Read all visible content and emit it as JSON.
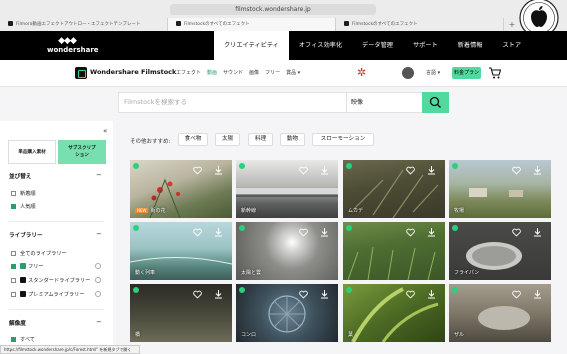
{
  "browser": {
    "url": "filmstock.wondershare.jp",
    "tabs": [
      {
        "label": "Filmora動画エフェクトアウトロー・エフェクトテンプレート",
        "active": true
      },
      {
        "label": "Filmstockのすべてのエフェクト",
        "active": false
      },
      {
        "label": "Filmstockのすべてのエフェクト",
        "active": false
      }
    ],
    "status_url": "https://filmstock.wondershare.jp/c/Forest.html\" を新規タブで開く"
  },
  "ws_nav": {
    "logo": "wondershare",
    "items": [
      {
        "label": "クリエイティビティ",
        "active": true
      },
      {
        "label": "オフィス効率化",
        "active": false
      },
      {
        "label": "データ管理",
        "active": false
      },
      {
        "label": "サポート",
        "active": false
      },
      {
        "label": "新着情報",
        "active": false
      },
      {
        "label": "ストア",
        "active": false
      }
    ]
  },
  "fs_bar": {
    "name": "Wondershare Filmstock",
    "categories": [
      {
        "label": "エフェクト",
        "highlight": false
      },
      {
        "label": "動画",
        "highlight": true
      },
      {
        "label": "サウンド",
        "highlight": false
      },
      {
        "label": "画像",
        "highlight": false
      },
      {
        "label": "フリー",
        "highlight": false
      },
      {
        "label": "賞品 ▾",
        "highlight": false
      }
    ],
    "lang": "言語 ▾",
    "plan_button": "料金プラン"
  },
  "search": {
    "placeholder": "Filmstockを検索する",
    "category": "映像"
  },
  "sidebar": {
    "tab_single": "単品購入素材",
    "tab_sub_line1": "サブスクリプ",
    "tab_sub_line2": "ション",
    "sort_title": "並び替え",
    "sort_options": [
      "新着順",
      "人気順"
    ],
    "library_title": "ライブラリー",
    "library_options": [
      "全てのライブラリー",
      "フリー",
      "スタンダードライブラリー",
      "プレミアムライブラリー"
    ],
    "resolution_title": "解像度",
    "resolution_options": [
      "すべて"
    ]
  },
  "suggestions": {
    "label": "その他おすすめ:",
    "chips": [
      "食べ物",
      "太陽",
      "料理",
      "動物",
      "スローモーション"
    ]
  },
  "videos": [
    {
      "title": "街の花",
      "new": "NEW"
    },
    {
      "title": "新幹線",
      "new": ""
    },
    {
      "title": "ムカデ",
      "new": ""
    },
    {
      "title": "牧場",
      "new": ""
    },
    {
      "title": "動く列車",
      "new": ""
    },
    {
      "title": "太陽と雲",
      "new": ""
    },
    {
      "title": "",
      "new": ""
    },
    {
      "title": "フライパン",
      "new": ""
    },
    {
      "title": "橋",
      "new": ""
    },
    {
      "title": "コンロ",
      "new": ""
    },
    {
      "title": "葉",
      "new": ""
    },
    {
      "title": "ザル",
      "new": ""
    }
  ],
  "colors": {
    "accent": "#52d9a0",
    "brand_dark": "#000000"
  }
}
